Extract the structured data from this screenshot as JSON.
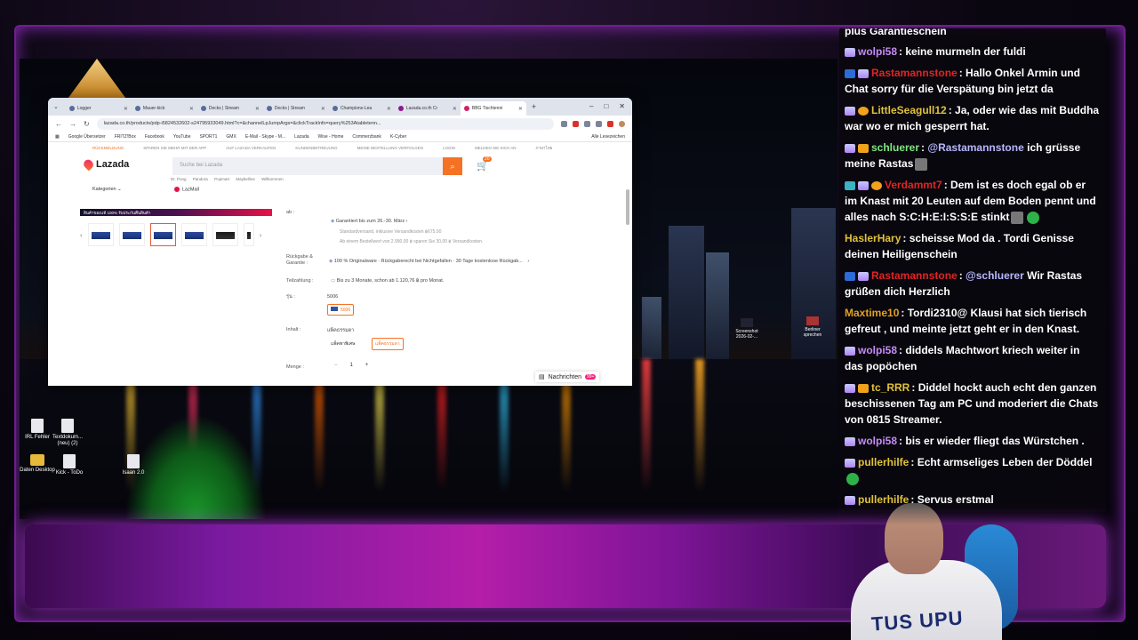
{
  "browser": {
    "tabs": [
      {
        "label": "Logger"
      },
      {
        "label": "Mauer-kick"
      },
      {
        "label": "Decks | Stream"
      },
      {
        "label": "Decks | Stream"
      },
      {
        "label": "Champions-Lea"
      },
      {
        "label": "Lazada.co.th Cr"
      },
      {
        "label": "BBG Tischtenni"
      }
    ],
    "url": "lazada.co.th/products/pdp-i5824532602-s24795933049.html?c=&channelLpJumpArgs=&clickTrackInfo=query%253Atabletenn...",
    "bookmarks": [
      "Google Übersetzer",
      "FRITZ!Box",
      "Facebook",
      "YouTube",
      "SPORT1",
      "GMX",
      "E-Mail - Skype - M...",
      "Lazada",
      "Wise - Home",
      "Commerzbank",
      "K-Cyber"
    ],
    "bookmarks_right": "Alle Lesezeichen"
  },
  "lazada": {
    "topnav": [
      "RÜCKMELDUNG",
      "SPAREN SIE MEHR MIT DER APP",
      "AUF LAZADA VERKAUFEN",
      "KUNDENBETREUUNG",
      "MEINE BESTELLUNG VERFOLGEN",
      "LOGIN",
      "MELDEN SIE SICH AN",
      "ภาษาไทย"
    ],
    "logo": "Lazada",
    "search_placeholder": "Suche bei Lazada",
    "cart_count": "20",
    "suggestions": [
      "Dr. Pong",
      "Pandora",
      "Popmart",
      "Maybelline",
      "Willkommen"
    ],
    "categories_label": "Kategorien",
    "mall_label": "LazMall",
    "banner_text": "สินค้าของแท้ 100% รับประกันคืนสินค้า",
    "delivery_label": "ab :",
    "delivery_guarantee": "Garantiert bis zum 26.-30. März",
    "delivery_standard": "Standardversand, inklusive Versandkosten ฿675.00",
    "delivery_promo": "Ab einem Bestellwert von 2.990,00 ฿ sparen Sie 30,00 ฿ Versandkosten.",
    "return_label": "Rückgabe & Garantie :",
    "return_value": "100 % Originalware · Rückgaberecht bei Nichtgefallen · 30 Tage kostenlose Rückgab...",
    "installment_label": "Teilzahlung :",
    "installment_value": "Bis zu 3 Monate, schon ab 1.120,76 ฿ pro Monat.",
    "model_label": "รุ่น :",
    "model_value": "5006",
    "model_chip": "5006",
    "content_label": "Inhalt :",
    "content_value": "แพ็คธรรมดา",
    "content_options": [
      "แพ็คพาพิเศษ",
      "แพ็คธรรมดา"
    ],
    "qty_label": "Menge :",
    "qty_minus": "−",
    "qty_value": "1",
    "qty_plus": "+",
    "messages_label": "Nachrichten"
  },
  "desktop": {
    "icons": [
      {
        "label": "IRL Fehler"
      },
      {
        "label": "Textdokum... (neu) (2)"
      },
      {
        "label": "Daten Desktop"
      },
      {
        "label": "Kick - ToDo"
      },
      {
        "label": "Isaan 2.0"
      }
    ],
    "right_icons": [
      {
        "label": "Screenshot 2026-02-..."
      },
      {
        "label": "Berliner sprechen"
      }
    ]
  },
  "chat": {
    "messages": [
      {
        "user": "",
        "text": "plus Garantieschein",
        "color": "#ffffff"
      },
      {
        "user": "wolpi58",
        "text": "keine murmeln der fuldi",
        "color": "#c58cf5"
      },
      {
        "user": "Rastamannstone",
        "text": "Hallo Onkel Armin und Chat sorry für die Verspätung bin jetzt da",
        "color": "#e02424"
      },
      {
        "user": "LittleSeagull12",
        "text": "Ja, oder wie das mit Buddha war wo er mich gesperrt hat.",
        "color": "#e0c23a"
      },
      {
        "user": "schluerer",
        "mention": "@Rastamannstone",
        "text": "ich grüsse meine Rastas",
        "color": "#7ee87e"
      },
      {
        "user": "Verdammt7",
        "text": "Dem  ist es doch egal ob er im Knast mit 20 Leuten auf dem Boden pennt und alles nach S:C:H:E:I:S:S:E stinkt",
        "color": "#e02424"
      },
      {
        "user": "HaslerHary",
        "text": "scheisse Mod da . Tordi Genisse deinen Heiligenschein",
        "color": "#e0c23a"
      },
      {
        "user": "Rastamannstone",
        "mention": "@schluerer",
        "text": "Wir Rastas grüßen dich Herzlich",
        "color": "#e02424"
      },
      {
        "user": "Maxtime10",
        "text": "Tordi2310@ Klausi hat sich tierisch gefreut , und meinte jetzt geht er in den Knast.",
        "color": "#e0a020"
      },
      {
        "user": "wolpi58",
        "text": "diddels Machtwort kriech weiter in das popöchen",
        "color": "#c58cf5"
      },
      {
        "user": "tc_RRR",
        "text": "Diddel hockt auch echt den ganzen beschissenen Tag am PC und moderiert die Chats von 0815 Streamer.",
        "color": "#e0c23a"
      },
      {
        "user": "wolpi58",
        "text": "bis er wieder fliegt das Würstchen .",
        "color": "#c58cf5"
      },
      {
        "user": "pullerhilfe",
        "text": "Echt armseliges Leben der Döddel",
        "color": "#e0c23a"
      },
      {
        "user": "pullerhilfe",
        "text": "Servus erstmal",
        "color": "#e0c23a"
      }
    ]
  },
  "webcam": {
    "shirt_text": "TUS UPU"
  }
}
